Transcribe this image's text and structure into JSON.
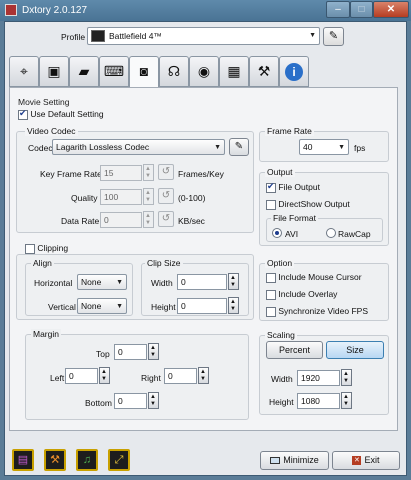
{
  "window": {
    "title": "Dxtory 2.0.127",
    "minimize_glyph": "–",
    "maximize_glyph": "□",
    "close_glyph": "✕"
  },
  "profile": {
    "label": "Profile",
    "value": "Battlefield 4™",
    "edit_icon": "pencil-icon",
    "edit_glyph": "✎"
  },
  "tabs": [
    {
      "icon": "crosshair-icon",
      "glyph": "⌖"
    },
    {
      "icon": "monitor-icon",
      "glyph": "▣"
    },
    {
      "icon": "folder-icon",
      "glyph": "▰"
    },
    {
      "icon": "keyboard-icon",
      "glyph": "⌨"
    },
    {
      "icon": "movie-camera-icon",
      "glyph": "◙"
    },
    {
      "icon": "headphones-icon",
      "glyph": "☊"
    },
    {
      "icon": "camera-icon",
      "glyph": "◉"
    },
    {
      "icon": "chip-icon",
      "glyph": "▦"
    },
    {
      "icon": "tools-icon",
      "glyph": "⚒"
    },
    {
      "icon": "info-icon",
      "glyph": "i"
    }
  ],
  "movie_setting": {
    "title": "Movie Setting",
    "use_default_label": "Use Default Setting",
    "use_default_checked": true
  },
  "video_codec": {
    "title": "Video Codec",
    "codec_label": "Codec",
    "codec_value": "Lagarith Lossless Codec",
    "key_frame_label": "Key Frame Rate",
    "key_frame_value": "15",
    "key_frame_unit": "Frames/Key",
    "quality_label": "Quality",
    "quality_value": "100",
    "quality_unit": "(0-100)",
    "data_rate_label": "Data Rate",
    "data_rate_value": "0",
    "data_rate_unit": "KB/sec"
  },
  "frame_rate": {
    "title": "Frame Rate",
    "value": "40",
    "unit": "fps"
  },
  "output": {
    "title": "Output",
    "file_output_label": "File Output",
    "file_output_checked": true,
    "directshow_label": "DirectShow Output",
    "directshow_checked": false,
    "file_format_title": "File Format",
    "avi_label": "AVI",
    "rawcap_label": "RawCap",
    "selected": "AVI"
  },
  "clipping": {
    "label": "Clipping",
    "checked": false,
    "align_title": "Align",
    "horizontal_label": "Horizontal",
    "horizontal_value": "None",
    "vertical_label": "Vertical",
    "vertical_value": "None",
    "clip_size_title": "Clip Size",
    "width_label": "Width",
    "width_value": "0",
    "height_label": "Height",
    "height_value": "0"
  },
  "margin": {
    "title": "Margin",
    "top_label": "Top",
    "top_value": "0",
    "left_label": "Left",
    "left_value": "0",
    "right_label": "Right",
    "right_value": "0",
    "bottom_label": "Bottom",
    "bottom_value": "0"
  },
  "option": {
    "title": "Option",
    "mouse_cursor_label": "Include Mouse Cursor",
    "overlay_label": "Include Overlay",
    "sync_fps_label": "Synchronize Video FPS"
  },
  "scaling": {
    "title": "Scaling",
    "percent_label": "Percent",
    "size_label": "Size",
    "selected": "Size",
    "width_label": "Width",
    "width_value": "1920",
    "height_label": "Height",
    "height_value": "1080"
  },
  "bottom": {
    "shortcuts": [
      {
        "icon": "window-icon",
        "glyph": "▤"
      },
      {
        "icon": "wrench-icon",
        "glyph": "⚒"
      },
      {
        "icon": "music-icon",
        "glyph": "♫"
      },
      {
        "icon": "resize-icon",
        "glyph": "⤢"
      }
    ],
    "minimize_label": "Minimize",
    "exit_label": "Exit"
  },
  "colors": {
    "accent_blue": "#3c7fb1",
    "exit_red": "#b53d22",
    "shortcut_border": "#c8a000"
  }
}
